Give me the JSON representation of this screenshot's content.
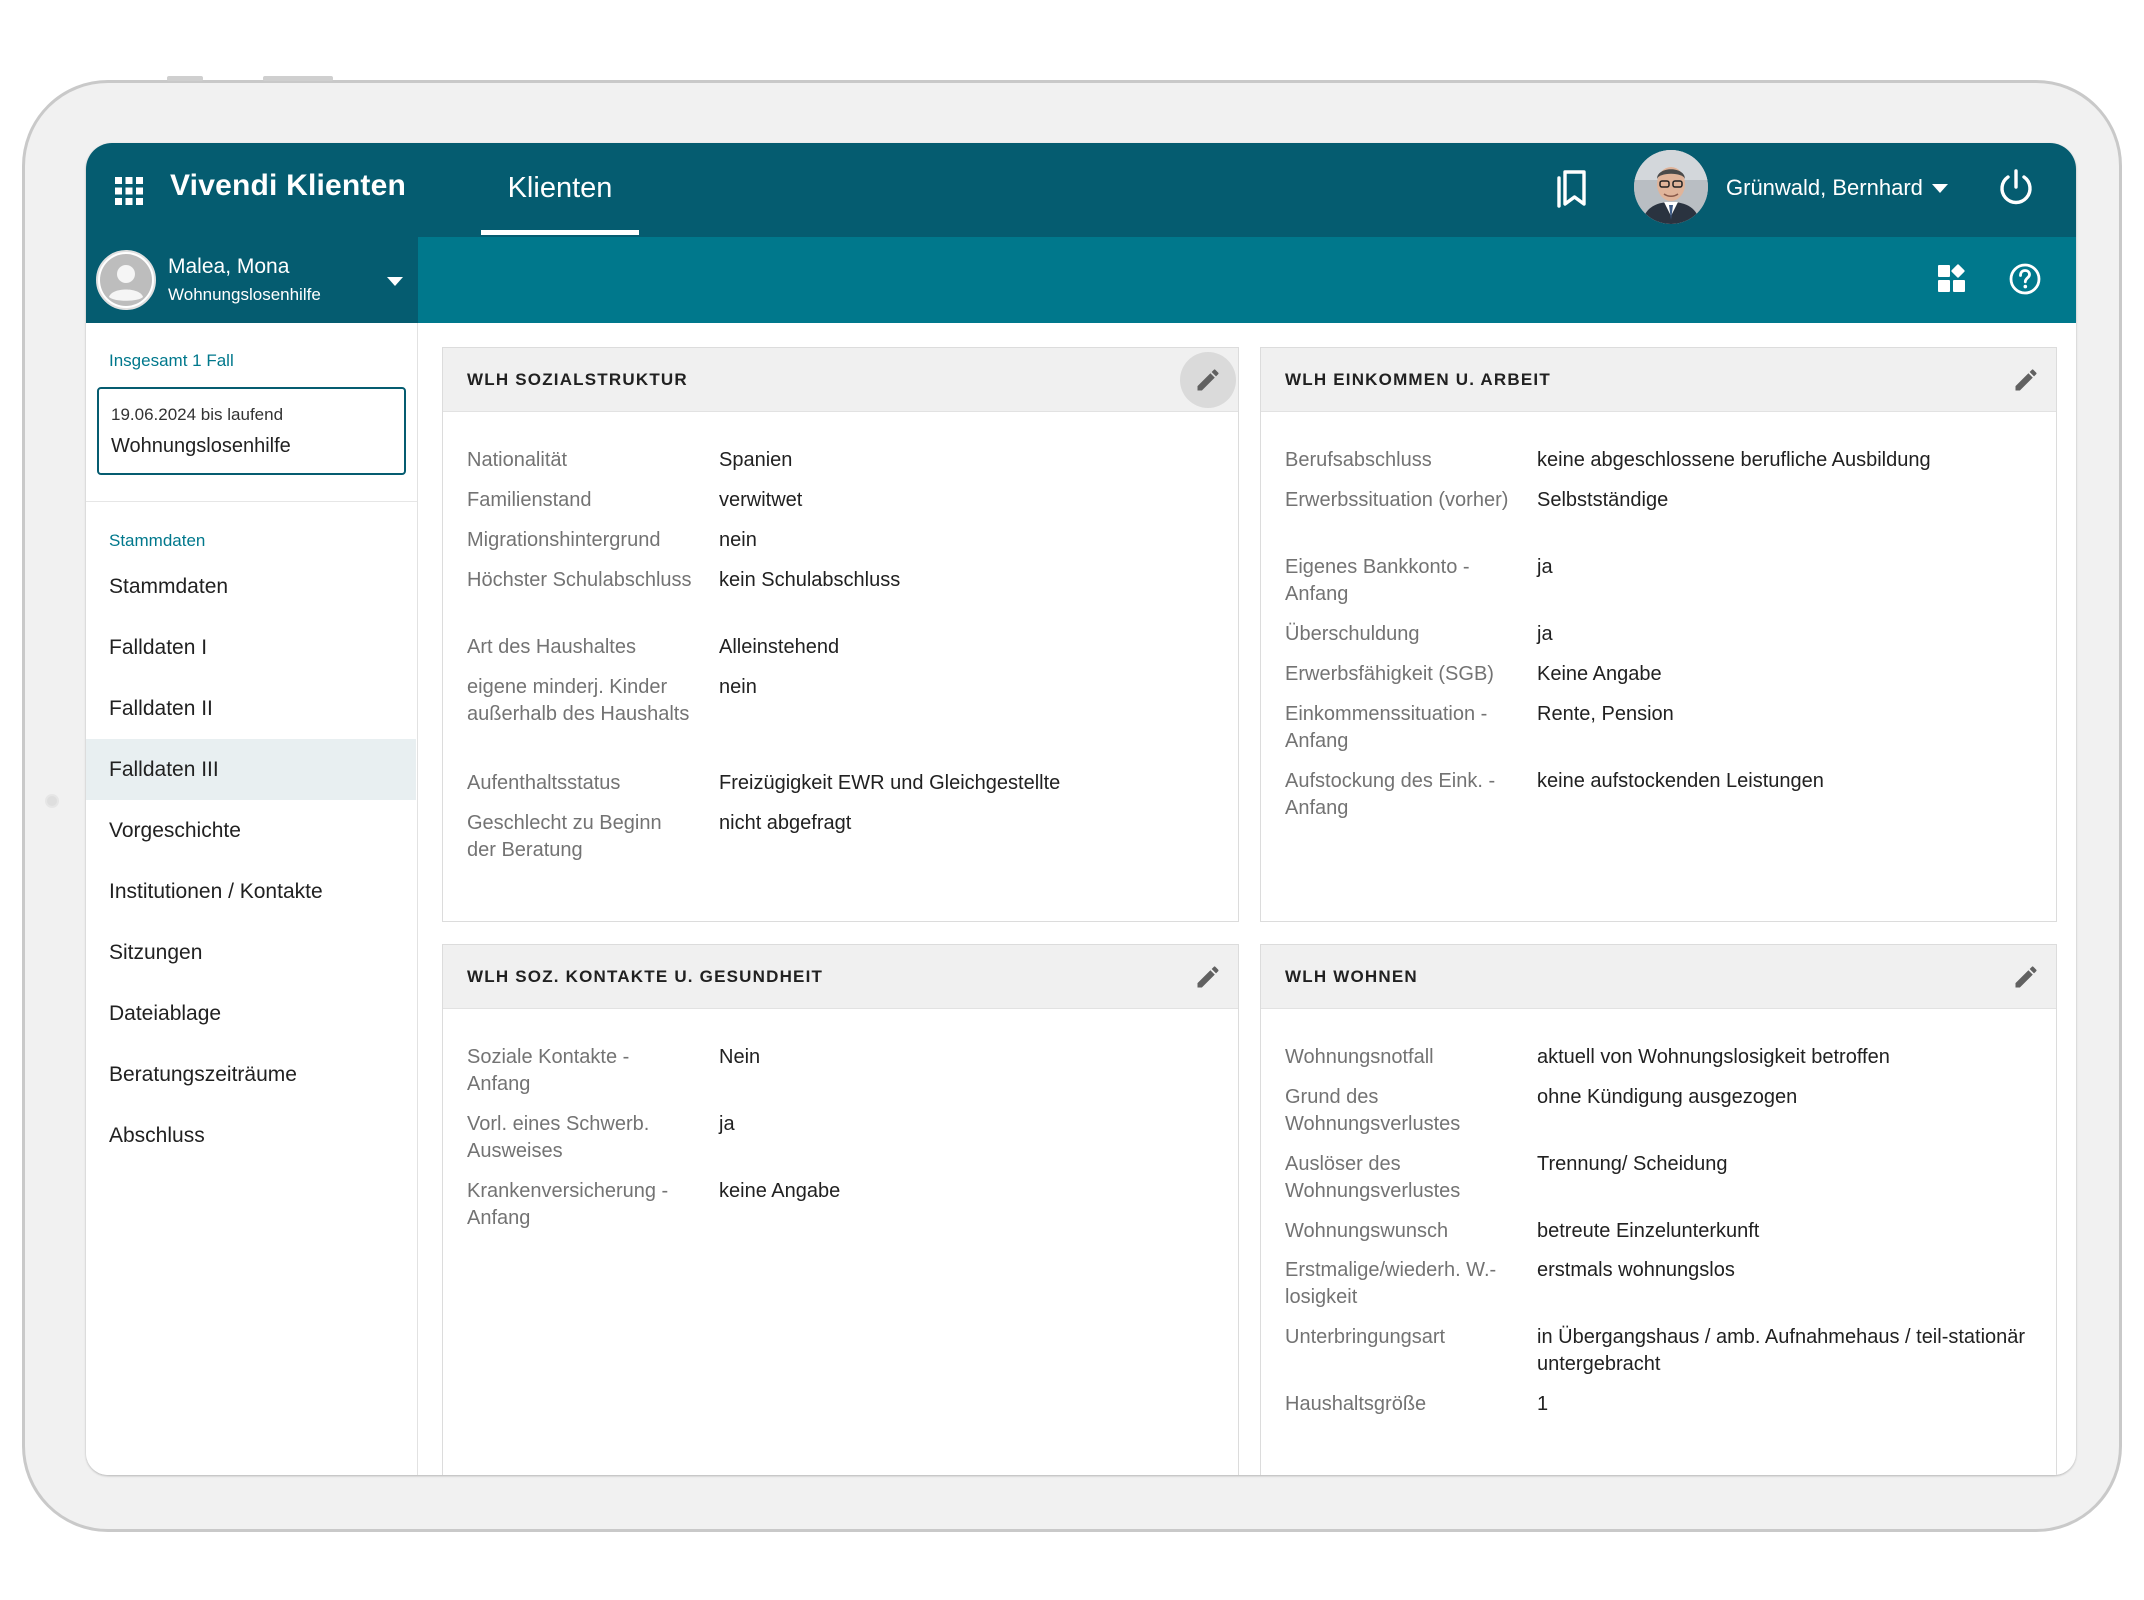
{
  "app": {
    "title": "Vivendi Klienten",
    "nav_tab": "Klienten"
  },
  "user": {
    "name": "Grünwald, Bernhard"
  },
  "client": {
    "name": "Malea, Mona",
    "program": "Wohnungslosenhilfe"
  },
  "sidebar": {
    "case_count": "Insgesamt 1 Fall",
    "case": {
      "date": "19.06.2024 bis laufend",
      "name": "Wohnungslosenhilfe"
    },
    "section": "Stammdaten",
    "items": [
      {
        "label": "Stammdaten"
      },
      {
        "label": "Falldaten I"
      },
      {
        "label": "Falldaten II"
      },
      {
        "label": "Falldaten III"
      },
      {
        "label": "Vorgeschichte"
      },
      {
        "label": "Institutionen / Kontakte"
      },
      {
        "label": "Sitzungen"
      },
      {
        "label": "Dateiablage"
      },
      {
        "label": "Beratungszeiträume"
      },
      {
        "label": "Abschluss"
      }
    ],
    "active_item": "Falldaten III"
  },
  "cards": {
    "sozialstruktur": {
      "title": "WLH SOZIALSTRUKTUR",
      "rows": [
        {
          "label": "Nationalität",
          "value": "Spanien"
        },
        {
          "label": "Familienstand",
          "value": "verwitwet"
        },
        {
          "label": "Migrationshintergrund",
          "value": "nein"
        },
        {
          "label": "Höchster Schulabschluss",
          "value": "kein Schulabschluss"
        },
        {
          "label": "Art des Haushaltes",
          "value": "Alleinstehend"
        },
        {
          "label": "eigene minderj. Kinder außerhalb des Haushalts",
          "value": "nein"
        },
        {
          "label": "Aufenthaltsstatus",
          "value": "Freizügigkeit EWR und Gleichgestellte"
        },
        {
          "label": "Geschlecht zu Beginn der Beratung",
          "value": "nicht abgefragt"
        }
      ]
    },
    "einkommen": {
      "title": "WLH EINKOMMEN U. ARBEIT",
      "rows": [
        {
          "label": "Berufsabschluss",
          "value": "keine abgeschlossene berufliche Ausbildung"
        },
        {
          "label": "Erwerbssituation (vorher)",
          "value": "Selbstständige"
        },
        {
          "label": "Eigenes Bankkonto - Anfang",
          "value": "ja"
        },
        {
          "label": "Überschuldung",
          "value": "ja"
        },
        {
          "label": "Erwerbsfähigkeit (SGB)",
          "value": "Keine Angabe"
        },
        {
          "label": "Einkommenssituation - Anfang",
          "value": "Rente, Pension"
        },
        {
          "label": "Aufstockung des Eink. - Anfang",
          "value": "keine aufstockenden Leistungen"
        }
      ]
    },
    "kontakte": {
      "title": "WLH SOZ. KONTAKTE U. GESUNDHEIT",
      "rows": [
        {
          "label": "Soziale Kontakte - Anfang",
          "value": "Nein"
        },
        {
          "label": "Vorl. eines Schwerb. Ausweises",
          "value": "ja"
        },
        {
          "label": "Krankenversicherung - Anfang",
          "value": "keine Angabe"
        }
      ]
    },
    "wohnen": {
      "title": "WLH WOHNEN",
      "rows": [
        {
          "label": "Wohnungsnotfall",
          "value": "aktuell von Wohnungslosigkeit betroffen"
        },
        {
          "label": "Grund des Wohnungsverlustes",
          "value": "ohne Kündigung ausgezogen"
        },
        {
          "label": "Auslöser des Wohnungsverlustes",
          "value": "Trennung/ Scheidung"
        },
        {
          "label": "Wohnungswunsch",
          "value": "betreute Einzelunterkunft"
        },
        {
          "label": "Erstmalige/wiederh. W.-losigkeit",
          "value": "erstmals wohnungslos"
        },
        {
          "label": "Unterbringungsart",
          "value": "in Übergangshaus / amb. Aufnahmehaus / teil-stationär untergebracht"
        },
        {
          "label": "Haushaltsgröße",
          "value": "1"
        }
      ]
    }
  },
  "colors": {
    "header": "#055c70",
    "subbar": "#00788c",
    "accent": "#00788c"
  }
}
